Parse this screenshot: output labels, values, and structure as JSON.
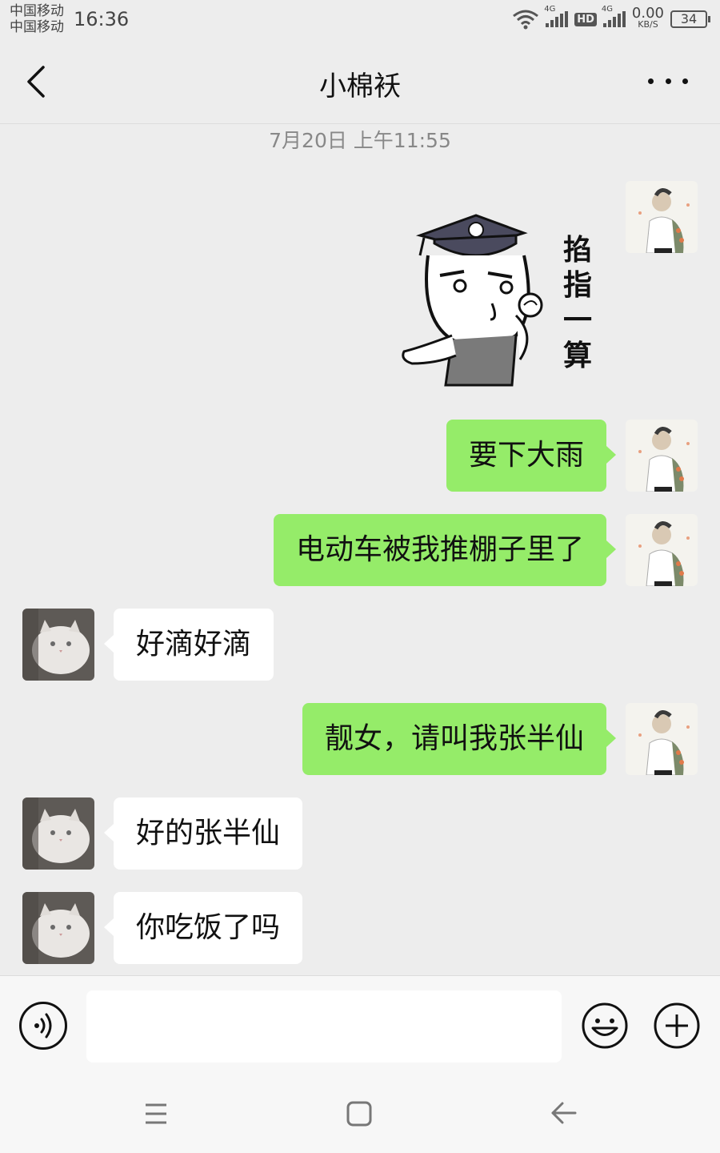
{
  "status_bar": {
    "carrier_1": "中国移动",
    "carrier_2": "中国移动",
    "time": "16:36",
    "network_1": "4G",
    "hd": "HD",
    "network_2": "4G",
    "speed_value": "0.00",
    "speed_unit": "KB/S",
    "battery": "34"
  },
  "header": {
    "title": "小棉袄",
    "back_icon": "chevron-left-icon",
    "more_icon": "more-dots-icon"
  },
  "chat": {
    "timestamp": "7月20日 上午11:55",
    "sticker_caption": "掐指一算",
    "messages": [
      {
        "sender": "me",
        "text": "要下大雨"
      },
      {
        "sender": "me",
        "text": "电动车被我推棚子里了"
      },
      {
        "sender": "them",
        "text": "好滴好滴"
      },
      {
        "sender": "me",
        "text": "靓女，请叫我张半仙"
      },
      {
        "sender": "them",
        "text": "好的张半仙"
      },
      {
        "sender": "them",
        "text": "你吃饭了吗"
      }
    ]
  },
  "input_bar": {
    "value": "",
    "voice_icon": "voice-icon",
    "emoji_icon": "emoji-icon",
    "plus_icon": "plus-icon"
  },
  "nav_bar": {
    "menu_icon": "menu-icon",
    "home_icon": "home-icon",
    "back_icon": "back-arrow-icon"
  },
  "colors": {
    "background": "#ededed",
    "my_bubble": "#95ec69",
    "their_bubble": "#ffffff"
  }
}
